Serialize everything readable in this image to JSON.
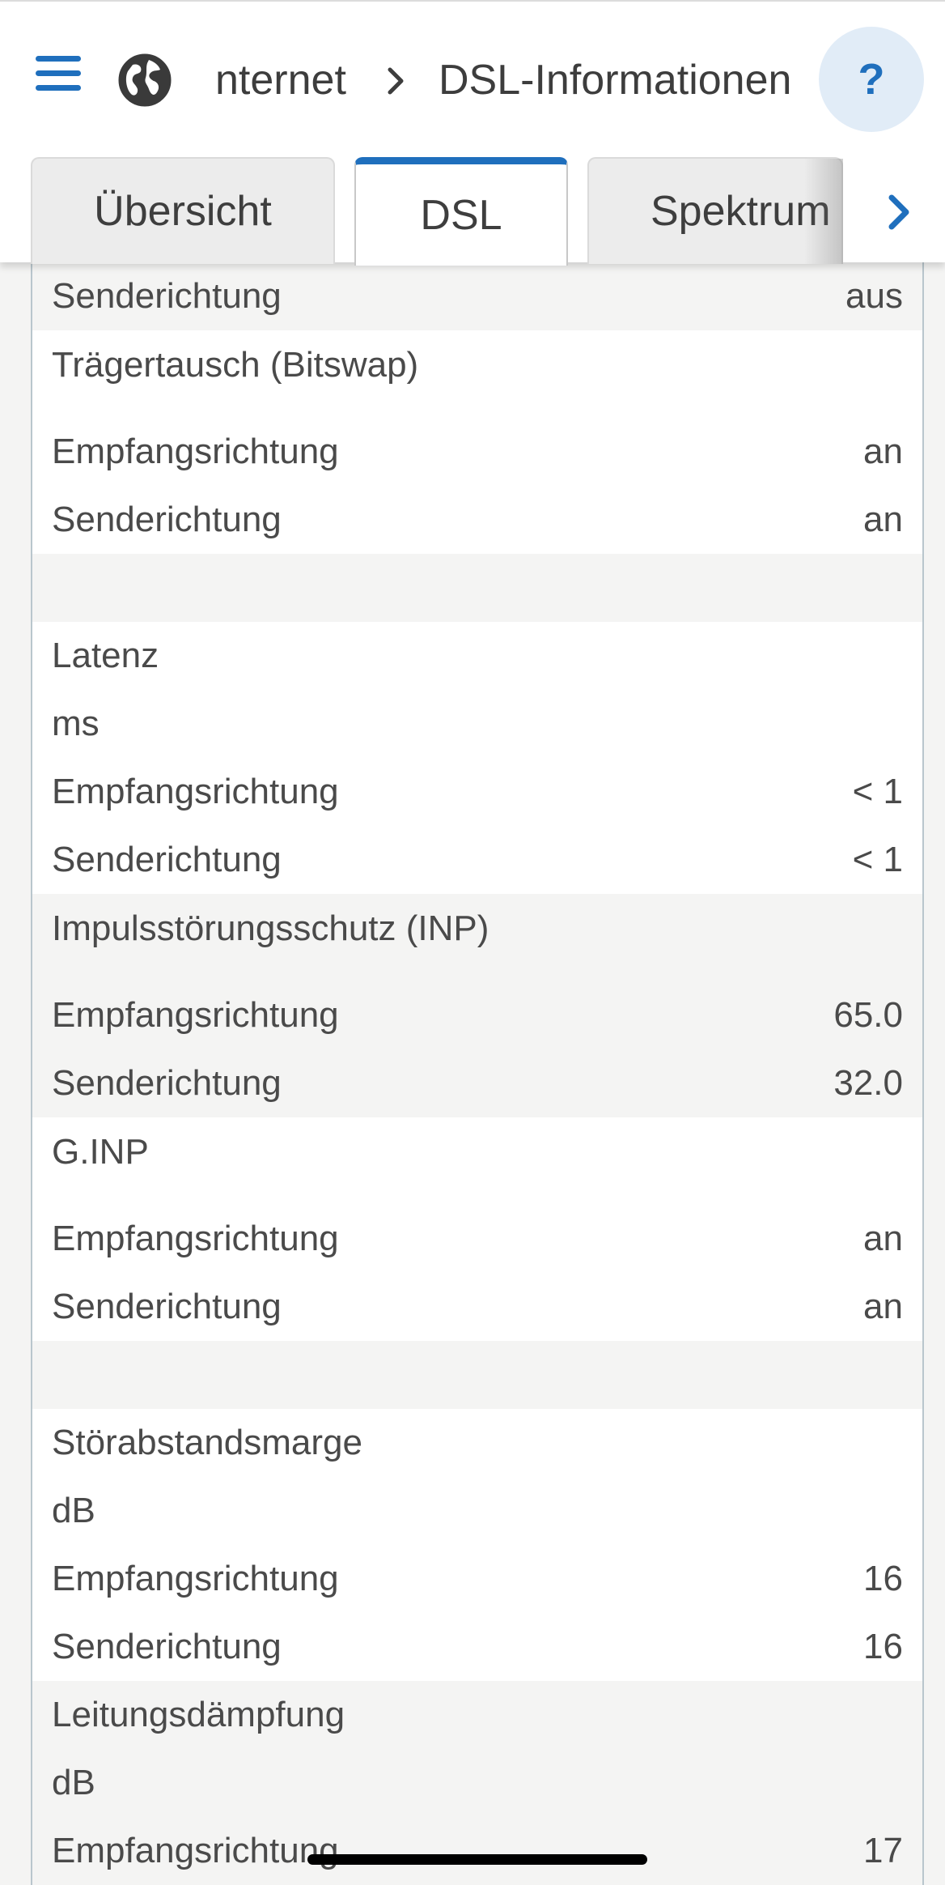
{
  "header": {
    "breadcrumb_1": "nternet",
    "breadcrumb_2": "DSL-Informationen",
    "help_label": "?"
  },
  "tabs": [
    {
      "label": "Übersicht"
    },
    {
      "label": "DSL"
    },
    {
      "label": "Spektrum"
    }
  ],
  "rows": [
    {
      "label": "Senderichtung",
      "value": "aus"
    },
    {
      "label": "Trägertausch (Bitswap)",
      "value": ""
    },
    {
      "label": "Empfangsrichtung",
      "value": "an"
    },
    {
      "label": "Senderichtung",
      "value": "an"
    },
    {
      "label": "Latenz",
      "value": ""
    },
    {
      "label": "ms",
      "value": ""
    },
    {
      "label": "Empfangsrichtung",
      "value": "< 1"
    },
    {
      "label": "Senderichtung",
      "value": "< 1"
    },
    {
      "label": "Impulsstörungsschutz (INP)",
      "value": ""
    },
    {
      "label": "Empfangsrichtung",
      "value": "65.0"
    },
    {
      "label": "Senderichtung",
      "value": "32.0"
    },
    {
      "label": "G.INP",
      "value": ""
    },
    {
      "label": "Empfangsrichtung",
      "value": "an"
    },
    {
      "label": "Senderichtung",
      "value": "an"
    },
    {
      "label": "Störabstandsmarge",
      "value": ""
    },
    {
      "label": "dB",
      "value": ""
    },
    {
      "label": "Empfangsrichtung",
      "value": "16"
    },
    {
      "label": "Senderichtung",
      "value": "16"
    },
    {
      "label": "Leitungsdämpfung",
      "value": ""
    },
    {
      "label": "dB",
      "value": ""
    },
    {
      "label": "Empfangsrichtung",
      "value": "17"
    }
  ],
  "colors": {
    "accent": "#1f6fbd",
    "help_background": "#e1ecf7",
    "row_shaded": "#f4f4f3",
    "row_plain": "#ffffff"
  }
}
